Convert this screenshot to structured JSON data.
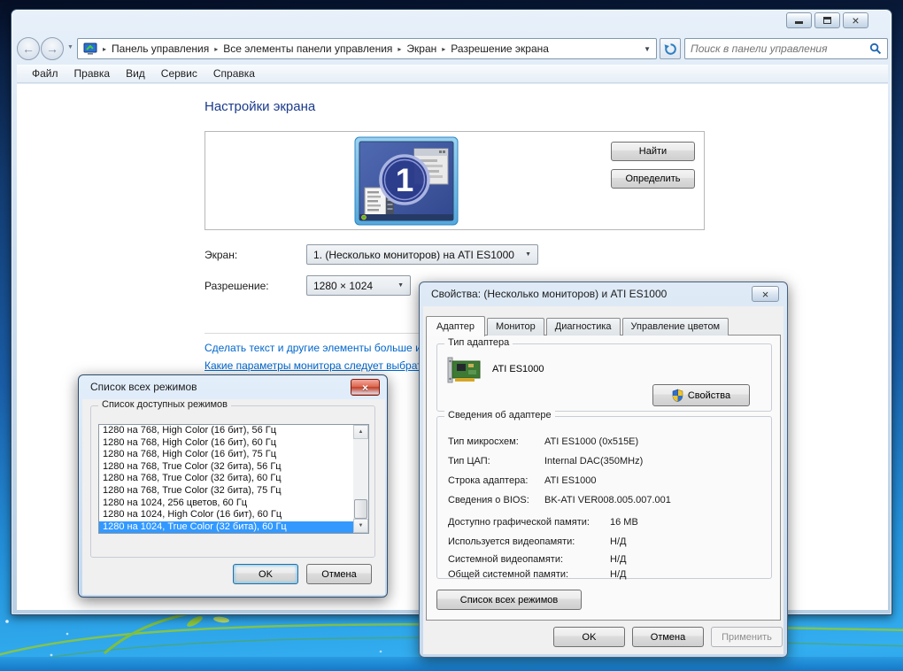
{
  "window": {
    "breadcrumb": [
      "Панель управления",
      "Все элементы панели управления",
      "Экран",
      "Разрешение экрана"
    ],
    "search_placeholder": "Поиск в панели управления",
    "menu": [
      "Файл",
      "Правка",
      "Вид",
      "Сервис",
      "Справка"
    ],
    "heading": "Настройки экрана",
    "find": "Найти",
    "identify": "Определить",
    "monitor_number": "1",
    "screen_label": "Экран:",
    "screen_value": "1. (Несколько мониторов) на ATI ES1000",
    "resolution_label": "Разрешение:",
    "resolution_value": "1280 × 1024",
    "link_text_size": "Сделать текст и другие элементы больше или меньше",
    "link_monitor_params": "Какие параметры монитора следует выбрать?"
  },
  "props": {
    "title": "Свойства: (Несколько мониторов) и ATI ES1000",
    "tabs": [
      "Адаптер",
      "Монитор",
      "Диагностика",
      "Управление цветом"
    ],
    "active_tab": "Адаптер",
    "adapter_type_label": "Тип адаптера",
    "adapter_name": "ATI ES1000",
    "properties_button": "Свойства",
    "adapter_info_label": "Сведения об адаптере",
    "info": [
      {
        "label": "Тип микросхем:",
        "value": "ATI ES1000 (0x515E)"
      },
      {
        "label": "Тип ЦАП:",
        "value": "Internal DAC(350MHz)"
      },
      {
        "label": "Строка адаптера:",
        "value": "ATI ES1000"
      },
      {
        "label": "Сведения о BIOS:",
        "value": "BK-ATI VER008.005.007.001"
      }
    ],
    "mem": [
      {
        "label": "Доступно графической памяти:",
        "value": "16 MB"
      },
      {
        "label": "Используется видеопамяти:",
        "value": "Н/Д"
      },
      {
        "label": "Системной видеопамяти:",
        "value": "Н/Д"
      },
      {
        "label": "Общей системной памяти:",
        "value": "Н/Д"
      }
    ],
    "list_modes_button": "Список всех режимов",
    "ok": "OK",
    "cancel": "Отмена",
    "apply": "Применить"
  },
  "modes": {
    "title": "Список всех режимов",
    "group_label": "Список доступных режимов",
    "items": [
      "1280 на 768, High Color (16 бит), 56 Гц",
      "1280 на 768, High Color (16 бит), 60 Гц",
      "1280 на 768, High Color (16 бит), 75 Гц",
      "1280 на 768, True Color (32 бита), 56 Гц",
      "1280 на 768, True Color (32 бита), 60 Гц",
      "1280 на 768, True Color (32 бита), 75 Гц",
      "1280 на 1024, 256 цветов, 60 Гц",
      "1280 на 1024, High Color (16 бит), 60 Гц",
      "1280 на 1024, True Color (32 бита), 60 Гц"
    ],
    "selected_index": 8,
    "ok": "OK",
    "cancel": "Отмена"
  },
  "colors": {
    "selection": "#3399ff",
    "link": "#0066cc",
    "heading": "#1a3a8c",
    "desktop_top": "#050e24",
    "desktop_bottom": "#33aef0"
  }
}
